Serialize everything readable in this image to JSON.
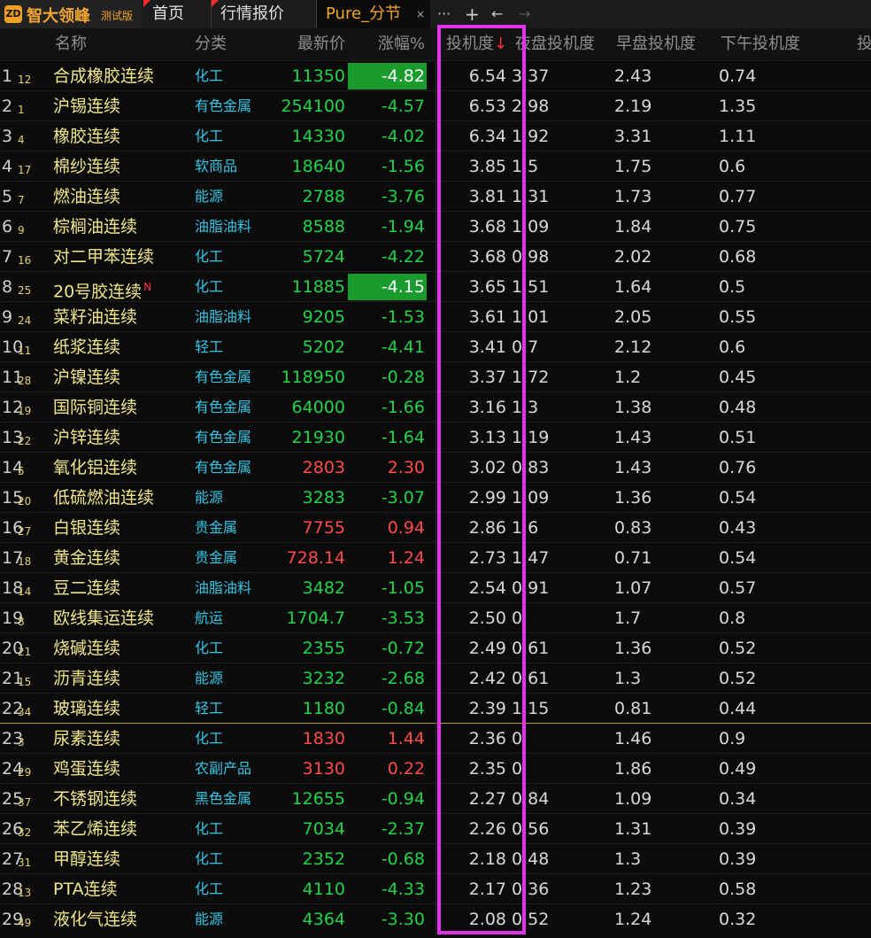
{
  "app": {
    "logo_mark": "ZD",
    "logo_text": "智大领峰",
    "logo_sub": "测试版"
  },
  "tabs": [
    {
      "label": "首页"
    },
    {
      "label": "行情报价"
    },
    {
      "label": "Pure_分节",
      "active": true,
      "close": "×"
    }
  ],
  "toolbar": {
    "more": "···",
    "add": "+",
    "back": "←",
    "forward": "→"
  },
  "columns": {
    "name": "名称",
    "category": "分类",
    "price": "最新价",
    "change": "涨幅%",
    "spec": "投机度",
    "sort_arrow": "↓",
    "night": "夜盘投机度",
    "morning": "早盘投机度",
    "afternoon": "下午投机度",
    "more": "投"
  },
  "colors": {
    "up": "#ff4a4a",
    "down": "#22d34a",
    "highlight": "#e233e8",
    "boxed_bg": "#1a9b2e"
  },
  "rows": [
    {
      "idx": "1",
      "sub": "12",
      "name": "合成橡胶连续",
      "cat": "化工",
      "price": "11350",
      "chg": "-4.82",
      "dir": "down",
      "boxed": true,
      "spec": "6.54",
      "night": "3.37",
      "morning": "2.43",
      "after": "0.74"
    },
    {
      "idx": "2",
      "sub": "1",
      "name": "沪锡连续",
      "cat": "有色金属",
      "price": "254100",
      "chg": "-4.57",
      "dir": "down",
      "spec": "6.53",
      "night": "2.98",
      "morning": "2.19",
      "after": "1.35"
    },
    {
      "idx": "3",
      "sub": "4",
      "name": "橡胶连续",
      "cat": "化工",
      "price": "14330",
      "chg": "-4.02",
      "dir": "down",
      "spec": "6.34",
      "night": "1.92",
      "morning": "3.31",
      "after": "1.11"
    },
    {
      "idx": "4",
      "sub": "17",
      "name": "棉纱连续",
      "cat": "软商品",
      "price": "18640",
      "chg": "-1.56",
      "dir": "down",
      "spec": "3.85",
      "night": "1.5",
      "morning": "1.75",
      "after": "0.6"
    },
    {
      "idx": "5",
      "sub": "7",
      "name": "燃油连续",
      "cat": "能源",
      "price": "2788",
      "chg": "-3.76",
      "dir": "down",
      "spec": "3.81",
      "night": "1.31",
      "morning": "1.73",
      "after": "0.77"
    },
    {
      "idx": "6",
      "sub": "9",
      "name": "棕榈油连续",
      "cat": "油脂油料",
      "price": "8588",
      "chg": "-1.94",
      "dir": "down",
      "spec": "3.68",
      "night": "1.09",
      "morning": "1.84",
      "after": "0.75"
    },
    {
      "idx": "7",
      "sub": "16",
      "name": "对二甲苯连续",
      "cat": "化工",
      "price": "5724",
      "chg": "-4.22",
      "dir": "down",
      "spec": "3.68",
      "night": "0.98",
      "morning": "2.02",
      "after": "0.68"
    },
    {
      "idx": "8",
      "sub": "25",
      "name": "20号胶连续",
      "mark": "N",
      "cat": "化工",
      "price": "11885",
      "chg": "-4.15",
      "dir": "down",
      "boxed": true,
      "spec": "3.65",
      "night": "1.51",
      "morning": "1.64",
      "after": "0.5"
    },
    {
      "idx": "9",
      "sub": "24",
      "name": "菜籽油连续",
      "cat": "油脂油料",
      "price": "9205",
      "chg": "-1.53",
      "dir": "down",
      "spec": "3.61",
      "night": "1.01",
      "morning": "2.05",
      "after": "0.55"
    },
    {
      "idx": "10",
      "sub": "11",
      "name": "纸浆连续",
      "cat": "轻工",
      "price": "5202",
      "chg": "-4.41",
      "dir": "down",
      "spec": "3.41",
      "night": "0.7",
      "morning": "2.12",
      "after": "0.6"
    },
    {
      "idx": "11",
      "sub": "28",
      "name": "沪镍连续",
      "cat": "有色金属",
      "price": "118950",
      "chg": "-0.28",
      "dir": "down",
      "spec": "3.37",
      "night": "1.72",
      "morning": "1.2",
      "after": "0.45"
    },
    {
      "idx": "12",
      "sub": "19",
      "name": "国际铜连续",
      "cat": "有色金属",
      "price": "64000",
      "chg": "-1.66",
      "dir": "down",
      "spec": "3.16",
      "night": "1.3",
      "morning": "1.38",
      "after": "0.48"
    },
    {
      "idx": "13",
      "sub": "22",
      "name": "沪锌连续",
      "cat": "有色金属",
      "price": "21930",
      "chg": "-1.64",
      "dir": "down",
      "spec": "3.13",
      "night": "1.19",
      "morning": "1.43",
      "after": "0.51"
    },
    {
      "idx": "14",
      "sub": "5",
      "name": "氧化铝连续",
      "cat": "有色金属",
      "price": "2803",
      "chg": "2.30",
      "dir": "up",
      "spec": "3.02",
      "night": "0.83",
      "morning": "1.43",
      "after": "0.76"
    },
    {
      "idx": "15",
      "sub": "20",
      "name": "低硫燃油连续",
      "cat": "能源",
      "price": "3283",
      "chg": "-3.07",
      "dir": "down",
      "spec": "2.99",
      "night": "1.09",
      "morning": "1.36",
      "after": "0.54"
    },
    {
      "idx": "16",
      "sub": "27",
      "name": "白银连续",
      "cat": "贵金属",
      "price": "7755",
      "chg": "0.94",
      "dir": "up",
      "spec": "2.86",
      "night": "1.6",
      "morning": "0.83",
      "after": "0.43"
    },
    {
      "idx": "17",
      "sub": "18",
      "name": "黄金连续",
      "cat": "贵金属",
      "price": "728.14",
      "chg": "1.24",
      "dir": "up",
      "spec": "2.73",
      "night": "1.47",
      "morning": "0.71",
      "after": "0.54"
    },
    {
      "idx": "18",
      "sub": "14",
      "name": "豆二连续",
      "cat": "油脂油料",
      "price": "3482",
      "chg": "-1.05",
      "dir": "down",
      "spec": "2.54",
      "night": "0.91",
      "morning": "1.07",
      "after": "0.57"
    },
    {
      "idx": "19",
      "sub": "8",
      "name": "欧线集运连续",
      "cat": "航运",
      "price": "1704.7",
      "chg": "-3.53",
      "dir": "down",
      "spec": "2.50",
      "night": "0",
      "morning": "1.7",
      "after": "0.8"
    },
    {
      "idx": "20",
      "sub": "21",
      "name": "烧碱连续",
      "cat": "化工",
      "price": "2355",
      "chg": "-0.72",
      "dir": "down",
      "spec": "2.49",
      "night": "0.61",
      "morning": "1.36",
      "after": "0.52"
    },
    {
      "idx": "21",
      "sub": "15",
      "name": "沥青连续",
      "cat": "能源",
      "price": "3232",
      "chg": "-2.68",
      "dir": "down",
      "spec": "2.42",
      "night": "0.61",
      "morning": "1.3",
      "after": "0.52"
    },
    {
      "idx": "22",
      "sub": "34",
      "name": "玻璃连续",
      "cat": "轻工",
      "price": "1180",
      "chg": "-0.84",
      "dir": "down",
      "spec": "2.39",
      "night": "1.15",
      "morning": "0.81",
      "after": "0.44"
    },
    {
      "idx": "23",
      "sub": "3",
      "name": "尿素连续",
      "cat": "化工",
      "price": "1830",
      "chg": "1.44",
      "dir": "up",
      "sep": true,
      "spec": "2.36",
      "night": "0",
      "morning": "1.46",
      "after": "0.9"
    },
    {
      "idx": "24",
      "sub": "29",
      "name": "鸡蛋连续",
      "cat": "农副产品",
      "price": "3130",
      "chg": "0.22",
      "dir": "up",
      "spec": "2.35",
      "night": "0",
      "morning": "1.86",
      "after": "0.49"
    },
    {
      "idx": "25",
      "sub": "37",
      "name": "不锈钢连续",
      "cat": "黑色金属",
      "price": "12655",
      "chg": "-0.94",
      "dir": "down",
      "spec": "2.27",
      "night": "0.84",
      "morning": "1.09",
      "after": "0.34"
    },
    {
      "idx": "26",
      "sub": "32",
      "name": "苯乙烯连续",
      "cat": "化工",
      "price": "7034",
      "chg": "-2.37",
      "dir": "down",
      "spec": "2.26",
      "night": "0.56",
      "morning": "1.31",
      "after": "0.39"
    },
    {
      "idx": "27",
      "sub": "31",
      "name": "甲醇连续",
      "cat": "化工",
      "price": "2352",
      "chg": "-0.68",
      "dir": "down",
      "spec": "2.18",
      "night": "0.48",
      "morning": "1.3",
      "after": "0.39"
    },
    {
      "idx": "28",
      "sub": "13",
      "name": "PTA连续",
      "cat": "化工",
      "price": "4110",
      "chg": "-4.33",
      "dir": "down",
      "spec": "2.17",
      "night": "0.36",
      "morning": "1.23",
      "after": "0.58"
    },
    {
      "idx": "29",
      "sub": "49",
      "name": "液化气连续",
      "cat": "能源",
      "price": "4364",
      "chg": "-3.30",
      "dir": "down",
      "spec": "2.08",
      "night": "0.52",
      "morning": "1.24",
      "after": "0.32"
    }
  ]
}
